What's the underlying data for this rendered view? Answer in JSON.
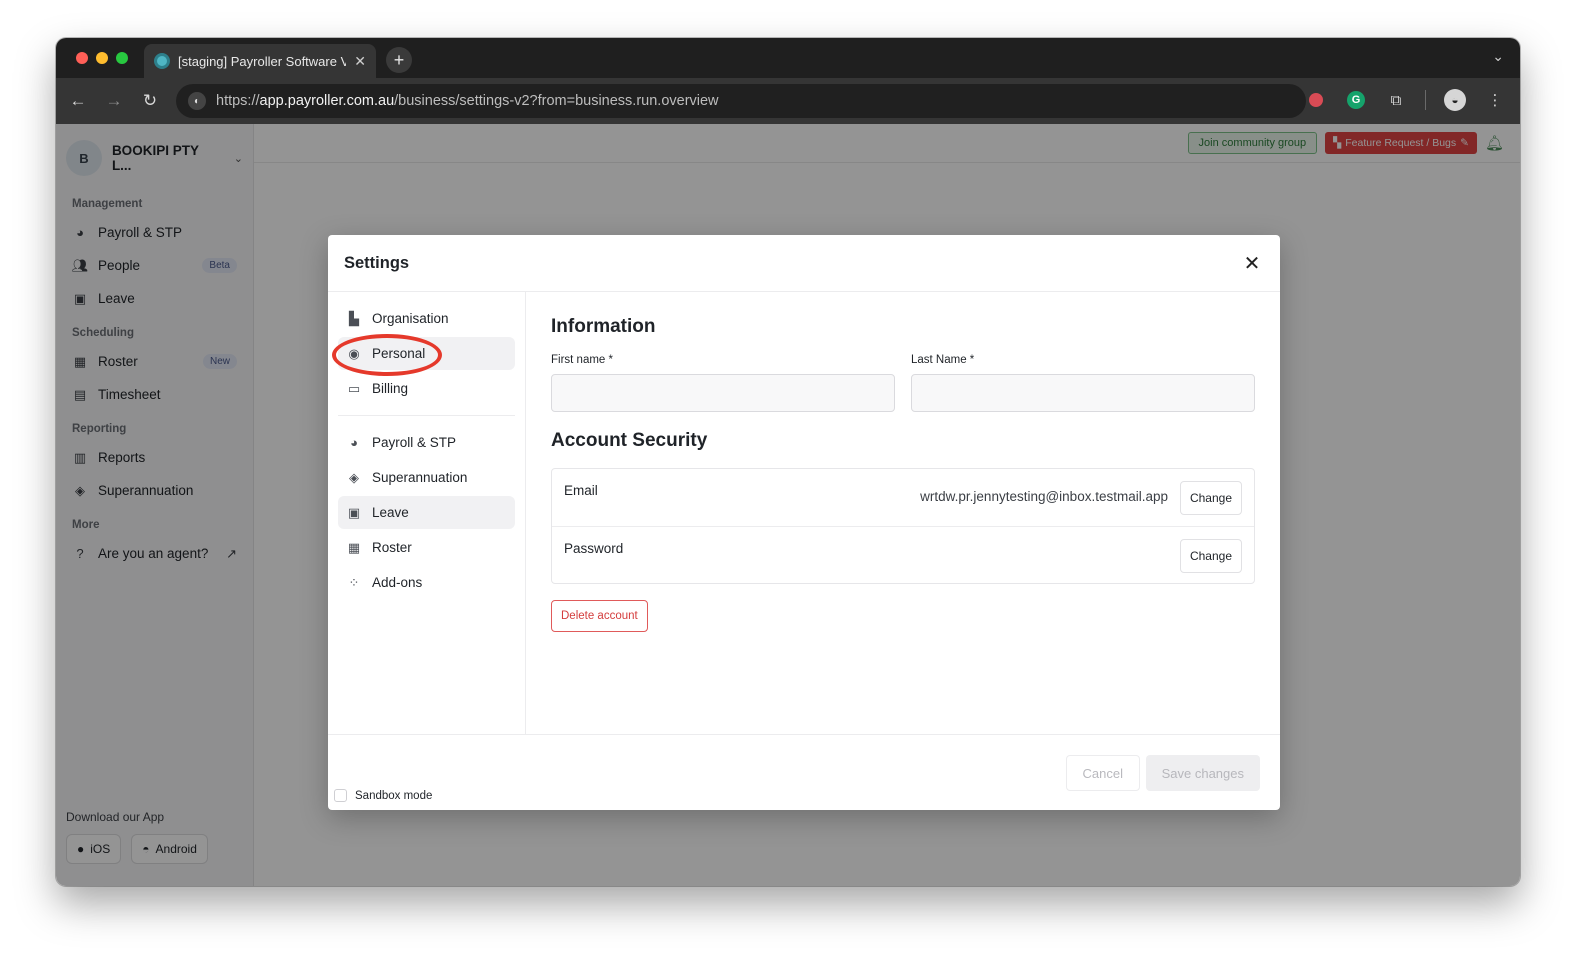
{
  "browser": {
    "tab_title": "[staging] Payroller Software V",
    "tab_close": "✕",
    "new_tab": "+",
    "url_host": "app.payroller.com.au",
    "url_scheme": "https://",
    "url_path": "/business/settings-v2?from=business.run.overview"
  },
  "sidebar": {
    "org_initial": "B",
    "org_name": "BOOKIPI PTY L...",
    "sections": {
      "management": "Management",
      "scheduling": "Scheduling",
      "reporting": "Reporting",
      "more": "More"
    },
    "items": {
      "payroll": "Payroll & STP",
      "people": "People",
      "people_badge": "Beta",
      "leave": "Leave",
      "roster": "Roster",
      "roster_badge": "New",
      "timesheet": "Timesheet",
      "reports": "Reports",
      "superannuation": "Superannuation",
      "agent": "Are you an agent?"
    },
    "download_title": "Download our App",
    "ios": "iOS",
    "android": "Android"
  },
  "topbar": {
    "community": "Join community group",
    "feature_request": "Feature Request / Bugs"
  },
  "modal": {
    "title": "Settings",
    "nav": {
      "organisation": "Organisation",
      "personal": "Personal",
      "billing": "Billing",
      "payroll": "Payroll & STP",
      "superannuation": "Superannuation",
      "leave": "Leave",
      "roster": "Roster",
      "addons": "Add-ons"
    },
    "information_heading": "Information",
    "first_name_label": "First name *",
    "first_name_value": "",
    "last_name_label": "Last Name *",
    "last_name_value": "",
    "security_heading": "Account Security",
    "email_label": "Email",
    "email_value": "wrtdw.pr.jennytesting@inbox.testmail.app",
    "password_label": "Password",
    "change_label": "Change",
    "delete_account": "Delete account",
    "sandbox_mode": "Sandbox mode",
    "cancel": "Cancel",
    "save_changes": "Save changes"
  },
  "colors": {
    "annotation_circle": "#e5392b",
    "delete_red": "#d43d3d"
  }
}
